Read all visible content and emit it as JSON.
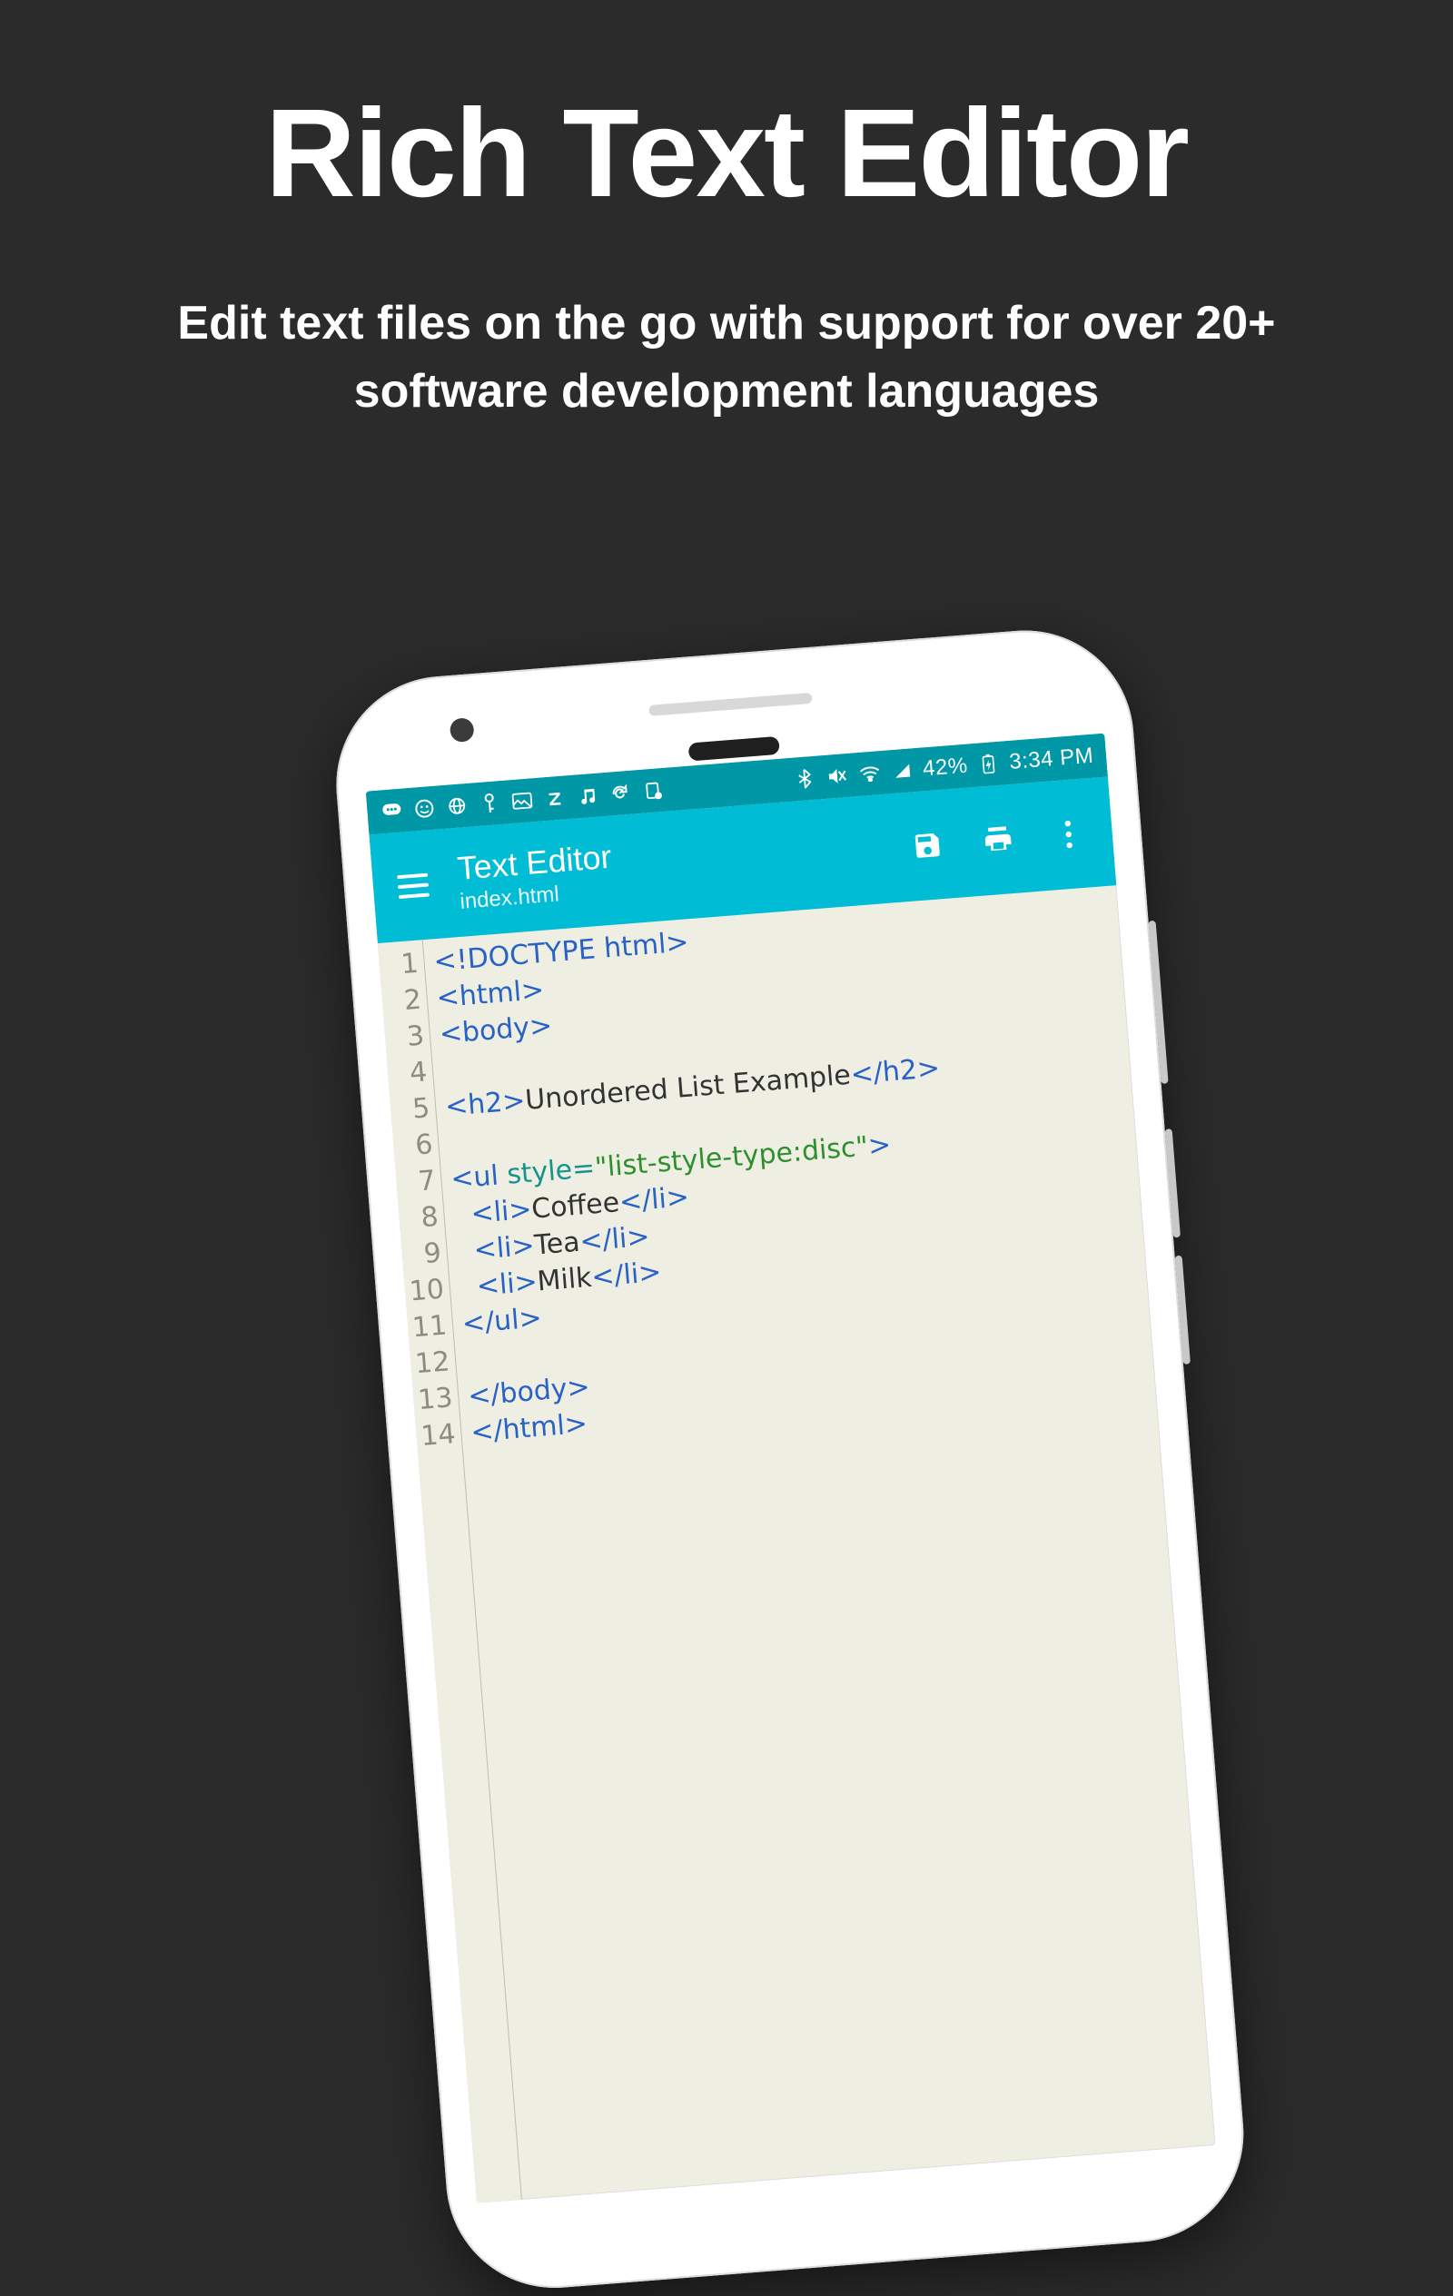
{
  "hero": {
    "title": "Rich Text Editor",
    "subtitle": "Edit text files on the go with support for over 20+ software development languages"
  },
  "status": {
    "battery": "42%",
    "time": "3:34 PM"
  },
  "appbar": {
    "title": "Text Editor",
    "filename": "index.html"
  },
  "code": {
    "lines": [
      {
        "n": "1",
        "segs": [
          {
            "c": "tag",
            "t": "<!DOCTYPE html>"
          }
        ]
      },
      {
        "n": "2",
        "segs": [
          {
            "c": "tag",
            "t": "<html>"
          }
        ]
      },
      {
        "n": "3",
        "segs": [
          {
            "c": "tag",
            "t": "<body>"
          }
        ]
      },
      {
        "n": "4",
        "segs": []
      },
      {
        "n": "5",
        "segs": [
          {
            "c": "tag",
            "t": "<h2>"
          },
          {
            "c": "txt",
            "t": "Unordered List Example"
          },
          {
            "c": "tag",
            "t": "</h2>"
          }
        ]
      },
      {
        "n": "6",
        "segs": []
      },
      {
        "n": "7",
        "segs": [
          {
            "c": "tag",
            "t": "<ul "
          },
          {
            "c": "attr",
            "t": "style="
          },
          {
            "c": "str",
            "t": "\"list-style-type:disc\""
          },
          {
            "c": "tag",
            "t": ">"
          }
        ]
      },
      {
        "n": "8",
        "segs": [
          {
            "c": "txt",
            "t": "  "
          },
          {
            "c": "tag",
            "t": "<li>"
          },
          {
            "c": "txt",
            "t": "Coffee"
          },
          {
            "c": "tag",
            "t": "</li>"
          }
        ]
      },
      {
        "n": "9",
        "segs": [
          {
            "c": "txt",
            "t": "  "
          },
          {
            "c": "tag",
            "t": "<li>"
          },
          {
            "c": "txt",
            "t": "Tea"
          },
          {
            "c": "tag",
            "t": "</li>"
          }
        ]
      },
      {
        "n": "10",
        "segs": [
          {
            "c": "txt",
            "t": "  "
          },
          {
            "c": "tag",
            "t": "<li>"
          },
          {
            "c": "txt",
            "t": "Milk"
          },
          {
            "c": "tag",
            "t": "</li>"
          }
        ]
      },
      {
        "n": "11",
        "segs": [
          {
            "c": "tag",
            "t": "</ul>"
          }
        ]
      },
      {
        "n": "12",
        "segs": []
      },
      {
        "n": "13",
        "segs": [
          {
            "c": "tag",
            "t": "</body>"
          }
        ]
      },
      {
        "n": "14",
        "segs": [
          {
            "c": "tag",
            "t": "</html>"
          }
        ]
      }
    ]
  },
  "icons": {
    "status_left": [
      "chat-icon",
      "face-icon",
      "globe-icon",
      "key-icon",
      "image-icon",
      "letter-z-icon",
      "music-icon",
      "refresh-icon",
      "screen-icon"
    ],
    "status_right": [
      "bluetooth-icon",
      "mute-icon",
      "wifi-icon",
      "cell-icon"
    ]
  }
}
